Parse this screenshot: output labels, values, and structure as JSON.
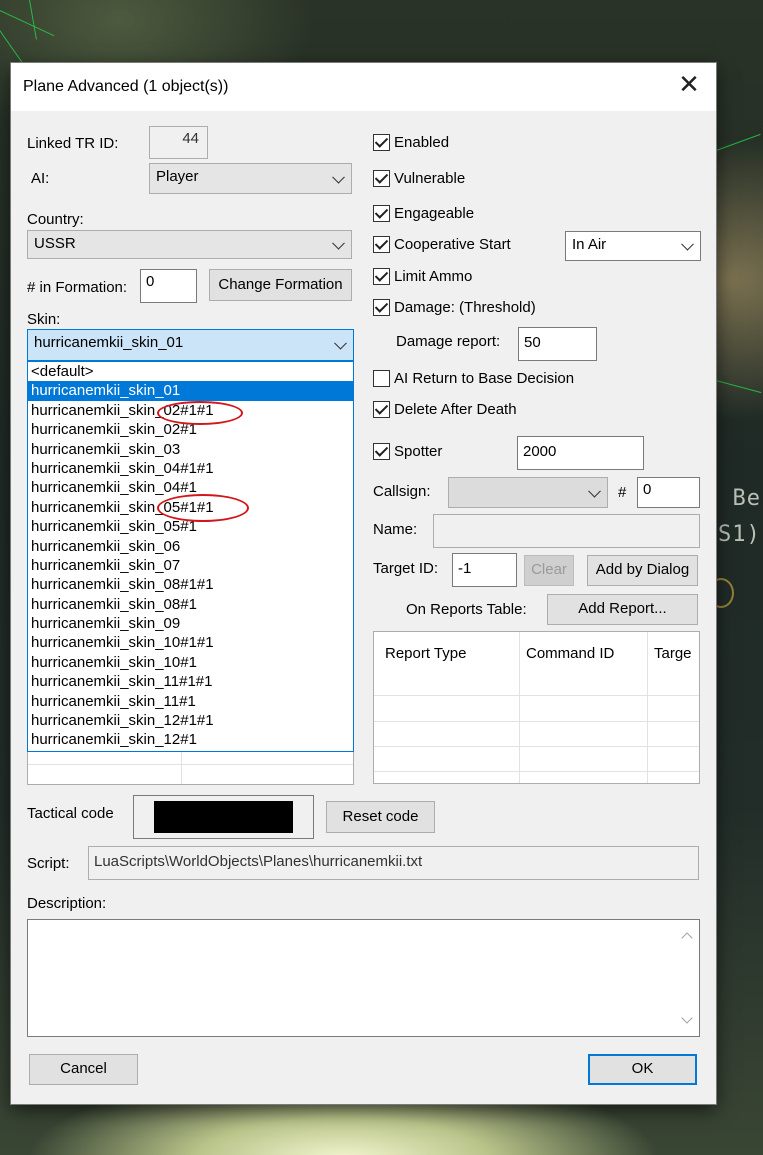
{
  "background": {
    "labels": [
      "n Be",
      "S1)"
    ]
  },
  "dialog": {
    "title": "Plane Advanced (1 object(s))",
    "close_glyph": "✕"
  },
  "left": {
    "linked_tr_label": "Linked TR ID:",
    "linked_tr_value": "44",
    "ai_label": "AI:",
    "ai_value": "Player",
    "country_label": "Country:",
    "country_value": "USSR",
    "formation_label": "# in Formation:",
    "formation_value": "0",
    "change_formation_label": "Change Formation",
    "skin_label": "Skin:",
    "skin_value": "hurricanemkii_skin_01",
    "skin_options": [
      "<default>",
      "hurricanemkii_skin_01",
      "hurricanemkii_skin_02#1#1",
      "hurricanemkii_skin_02#1",
      "hurricanemkii_skin_03",
      "hurricanemkii_skin_04#1#1",
      "hurricanemkii_skin_04#1",
      "hurricanemkii_skin_05#1#1",
      "hurricanemkii_skin_05#1",
      "hurricanemkii_skin_06",
      "hurricanemkii_skin_07",
      "hurricanemkii_skin_08#1#1",
      "hurricanemkii_skin_08#1",
      "hurricanemkii_skin_09",
      "hurricanemkii_skin_10#1#1",
      "hurricanemkii_skin_10#1",
      "hurricanemkii_skin_11#1#1",
      "hurricanemkii_skin_11#1",
      "hurricanemkii_skin_12#1#1",
      "hurricanemkii_skin_12#1"
    ],
    "selected_skin_index": 1
  },
  "right": {
    "enabled_label": "Enabled",
    "enabled_checked": true,
    "vulnerable_label": "Vulnerable",
    "vulnerable_checked": true,
    "engageable_label": "Engageable",
    "engageable_checked": true,
    "coop_start_label": "Cooperative Start",
    "coop_start_checked": true,
    "coop_start_value": "In Air",
    "limit_ammo_label": "Limit Ammo",
    "limit_ammo_checked": true,
    "damage_label": "Damage: (Threshold)",
    "damage_checked": true,
    "damage_report_label": "Damage report:",
    "damage_report_value": "50",
    "ai_rtb_label": "AI Return to Base Decision",
    "ai_rtb_checked": false,
    "delete_after_death_label": "Delete After Death",
    "delete_after_death_checked": true,
    "spotter_label": "Spotter",
    "spotter_checked": true,
    "spotter_value": "2000",
    "callsign_label": "Callsign:",
    "callsign_value": "",
    "hash_label": "#",
    "hash_value": "0",
    "name_label": "Name:",
    "name_value": "",
    "target_id_label": "Target ID:",
    "target_id_value": "-1",
    "clear_label": "Clear",
    "add_by_dialog_label": "Add by Dialog",
    "on_reports_label": "On Reports Table:",
    "add_report_label": "Add Report...",
    "reports_columns": [
      "Report Type",
      "Command ID",
      "Targe"
    ]
  },
  "bottom": {
    "tactical_code_label": "Tactical code",
    "reset_code_label": "Reset code",
    "script_label": "Script:",
    "script_value": "LuaScripts\\WorldObjects\\Planes\\hurricanemkii.txt",
    "description_label": "Description:",
    "description_value": "",
    "cancel_label": "Cancel",
    "ok_label": "OK"
  },
  "colors": {
    "selection": "#0078d7",
    "annotation_circle": "#d3161b",
    "radar_lines": "#27d34a"
  }
}
